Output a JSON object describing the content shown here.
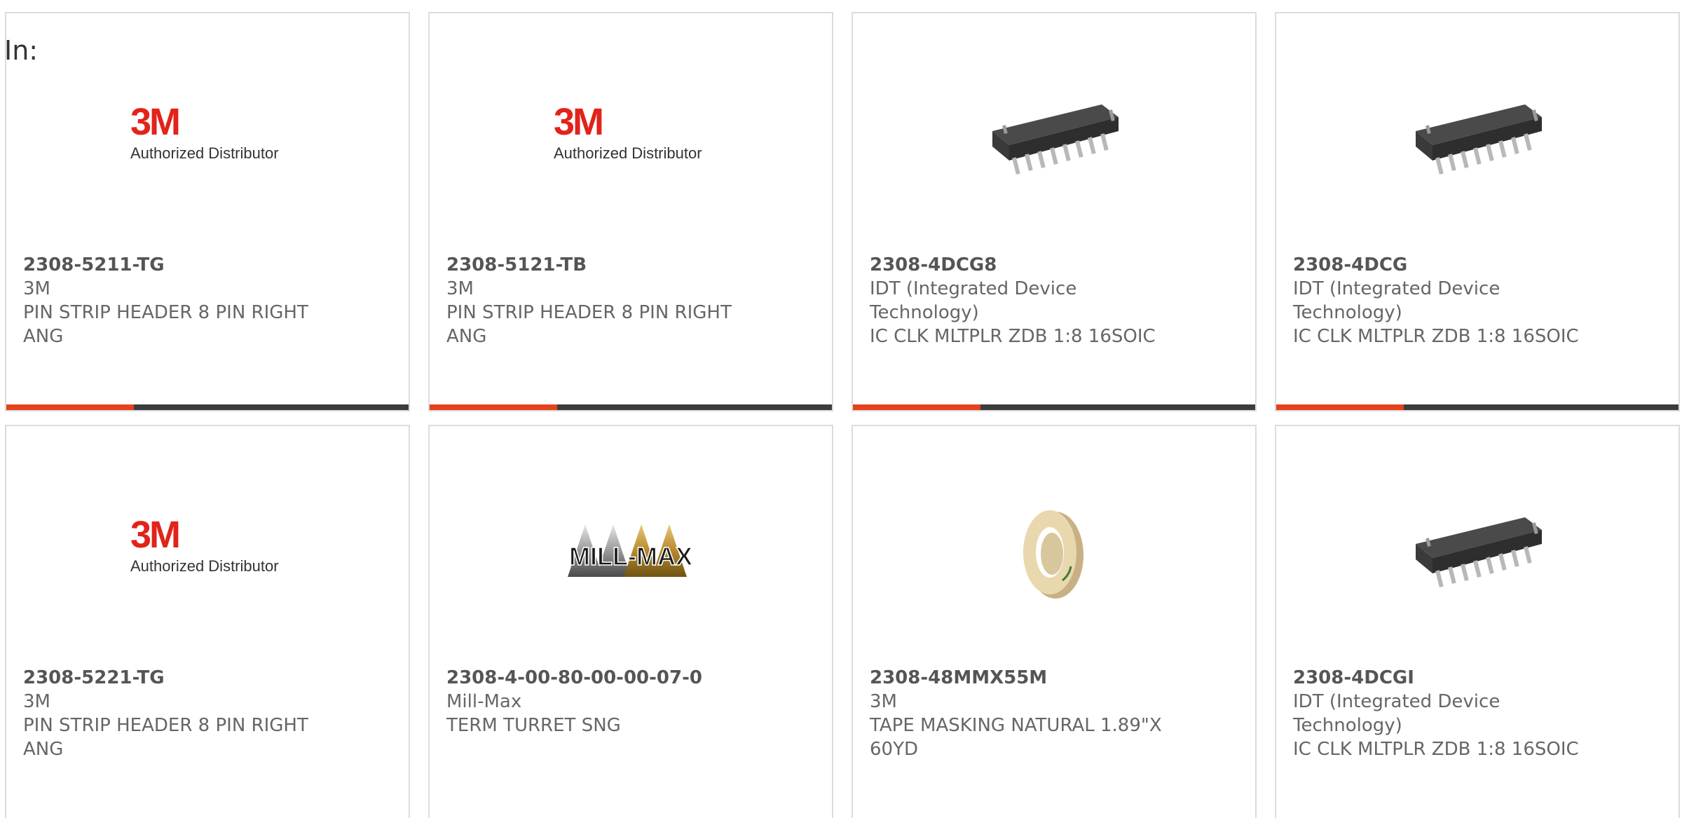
{
  "header": {
    "in_label": "In:"
  },
  "colors": {
    "accent": "#e4421c",
    "bar": "#3c3c3c",
    "border": "#dcdcdc",
    "brand_3m": "#e2231a"
  },
  "products": [
    {
      "part_number": "2308-5211-TG",
      "manufacturer": "3M",
      "description": "PIN STRIP HEADER 8 PIN RIGHT ANG",
      "image": "3m-authorized-distributor-logo",
      "logo_text": "3M",
      "logo_subtext": "Authorized Distributor"
    },
    {
      "part_number": "2308-5121-TB",
      "manufacturer": "3M",
      "description": "PIN STRIP HEADER 8 PIN RIGHT ANG",
      "image": "3m-authorized-distributor-logo",
      "logo_text": "3M",
      "logo_subtext": "Authorized Distributor"
    },
    {
      "part_number": "2308-4DCG8",
      "manufacturer": "IDT (Integrated Device Technology)",
      "description": "IC CLK MLTPLR ZDB 1:8 16SOIC",
      "image": "soic-16-chip"
    },
    {
      "part_number": "2308-4DCG",
      "manufacturer": "IDT (Integrated Device Technology)",
      "description": "IC CLK MLTPLR ZDB 1:8 16SOIC",
      "image": "soic-16-chip"
    },
    {
      "part_number": "2308-5221-TG",
      "manufacturer": "3M",
      "description": "PIN STRIP HEADER 8 PIN RIGHT ANG",
      "image": "3m-authorized-distributor-logo",
      "logo_text": "3M",
      "logo_subtext": "Authorized Distributor"
    },
    {
      "part_number": "2308-4-00-80-00-00-07-0",
      "manufacturer": "Mill-Max",
      "description": "TERM TURRET SNG",
      "image": "mill-max-logo",
      "logo_text": "MILL-MAX"
    },
    {
      "part_number": "2308-48MMX55M",
      "manufacturer": "3M",
      "description": "TAPE MASKING NATURAL 1.89\"X 60YD",
      "image": "masking-tape-roll"
    },
    {
      "part_number": "2308-4DCGI",
      "manufacturer": "IDT (Integrated Device Technology)",
      "description": "IC CLK MLTPLR ZDB 1:8 16SOIC",
      "image": "soic-16-chip"
    }
  ]
}
